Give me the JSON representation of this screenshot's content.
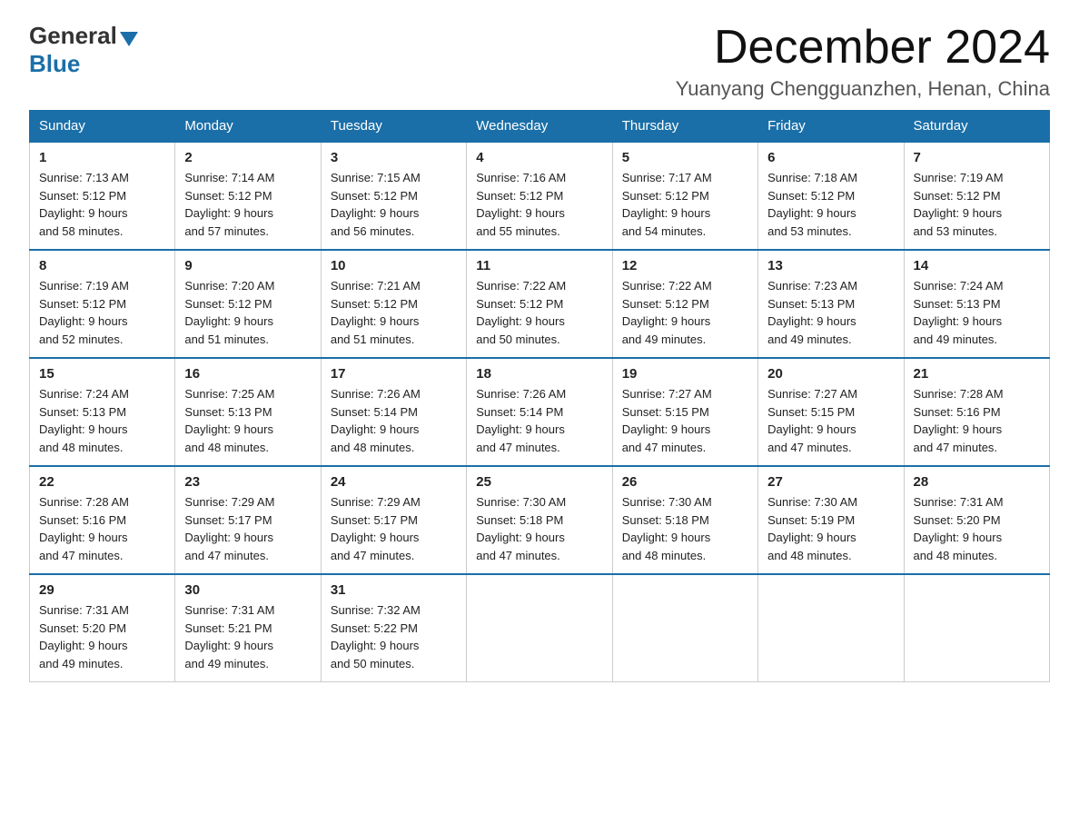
{
  "header": {
    "logo_general": "General",
    "logo_blue": "Blue",
    "month_title": "December 2024",
    "location": "Yuanyang Chengguanzhen, Henan, China"
  },
  "days_of_week": [
    "Sunday",
    "Monday",
    "Tuesday",
    "Wednesday",
    "Thursday",
    "Friday",
    "Saturday"
  ],
  "weeks": [
    [
      {
        "day": "1",
        "sunrise": "7:13 AM",
        "sunset": "5:12 PM",
        "daylight": "9 hours and 58 minutes."
      },
      {
        "day": "2",
        "sunrise": "7:14 AM",
        "sunset": "5:12 PM",
        "daylight": "9 hours and 57 minutes."
      },
      {
        "day": "3",
        "sunrise": "7:15 AM",
        "sunset": "5:12 PM",
        "daylight": "9 hours and 56 minutes."
      },
      {
        "day": "4",
        "sunrise": "7:16 AM",
        "sunset": "5:12 PM",
        "daylight": "9 hours and 55 minutes."
      },
      {
        "day": "5",
        "sunrise": "7:17 AM",
        "sunset": "5:12 PM",
        "daylight": "9 hours and 54 minutes."
      },
      {
        "day": "6",
        "sunrise": "7:18 AM",
        "sunset": "5:12 PM",
        "daylight": "9 hours and 53 minutes."
      },
      {
        "day": "7",
        "sunrise": "7:19 AM",
        "sunset": "5:12 PM",
        "daylight": "9 hours and 53 minutes."
      }
    ],
    [
      {
        "day": "8",
        "sunrise": "7:19 AM",
        "sunset": "5:12 PM",
        "daylight": "9 hours and 52 minutes."
      },
      {
        "day": "9",
        "sunrise": "7:20 AM",
        "sunset": "5:12 PM",
        "daylight": "9 hours and 51 minutes."
      },
      {
        "day": "10",
        "sunrise": "7:21 AM",
        "sunset": "5:12 PM",
        "daylight": "9 hours and 51 minutes."
      },
      {
        "day": "11",
        "sunrise": "7:22 AM",
        "sunset": "5:12 PM",
        "daylight": "9 hours and 50 minutes."
      },
      {
        "day": "12",
        "sunrise": "7:22 AM",
        "sunset": "5:12 PM",
        "daylight": "9 hours and 49 minutes."
      },
      {
        "day": "13",
        "sunrise": "7:23 AM",
        "sunset": "5:13 PM",
        "daylight": "9 hours and 49 minutes."
      },
      {
        "day": "14",
        "sunrise": "7:24 AM",
        "sunset": "5:13 PM",
        "daylight": "9 hours and 49 minutes."
      }
    ],
    [
      {
        "day": "15",
        "sunrise": "7:24 AM",
        "sunset": "5:13 PM",
        "daylight": "9 hours and 48 minutes."
      },
      {
        "day": "16",
        "sunrise": "7:25 AM",
        "sunset": "5:13 PM",
        "daylight": "9 hours and 48 minutes."
      },
      {
        "day": "17",
        "sunrise": "7:26 AM",
        "sunset": "5:14 PM",
        "daylight": "9 hours and 48 minutes."
      },
      {
        "day": "18",
        "sunrise": "7:26 AM",
        "sunset": "5:14 PM",
        "daylight": "9 hours and 47 minutes."
      },
      {
        "day": "19",
        "sunrise": "7:27 AM",
        "sunset": "5:15 PM",
        "daylight": "9 hours and 47 minutes."
      },
      {
        "day": "20",
        "sunrise": "7:27 AM",
        "sunset": "5:15 PM",
        "daylight": "9 hours and 47 minutes."
      },
      {
        "day": "21",
        "sunrise": "7:28 AM",
        "sunset": "5:16 PM",
        "daylight": "9 hours and 47 minutes."
      }
    ],
    [
      {
        "day": "22",
        "sunrise": "7:28 AM",
        "sunset": "5:16 PM",
        "daylight": "9 hours and 47 minutes."
      },
      {
        "day": "23",
        "sunrise": "7:29 AM",
        "sunset": "5:17 PM",
        "daylight": "9 hours and 47 minutes."
      },
      {
        "day": "24",
        "sunrise": "7:29 AM",
        "sunset": "5:17 PM",
        "daylight": "9 hours and 47 minutes."
      },
      {
        "day": "25",
        "sunrise": "7:30 AM",
        "sunset": "5:18 PM",
        "daylight": "9 hours and 47 minutes."
      },
      {
        "day": "26",
        "sunrise": "7:30 AM",
        "sunset": "5:18 PM",
        "daylight": "9 hours and 48 minutes."
      },
      {
        "day": "27",
        "sunrise": "7:30 AM",
        "sunset": "5:19 PM",
        "daylight": "9 hours and 48 minutes."
      },
      {
        "day": "28",
        "sunrise": "7:31 AM",
        "sunset": "5:20 PM",
        "daylight": "9 hours and 48 minutes."
      }
    ],
    [
      {
        "day": "29",
        "sunrise": "7:31 AM",
        "sunset": "5:20 PM",
        "daylight": "9 hours and 49 minutes."
      },
      {
        "day": "30",
        "sunrise": "7:31 AM",
        "sunset": "5:21 PM",
        "daylight": "9 hours and 49 minutes."
      },
      {
        "day": "31",
        "sunrise": "7:32 AM",
        "sunset": "5:22 PM",
        "daylight": "9 hours and 50 minutes."
      },
      null,
      null,
      null,
      null
    ]
  ],
  "labels": {
    "sunrise": "Sunrise:",
    "sunset": "Sunset:",
    "daylight": "Daylight:"
  }
}
